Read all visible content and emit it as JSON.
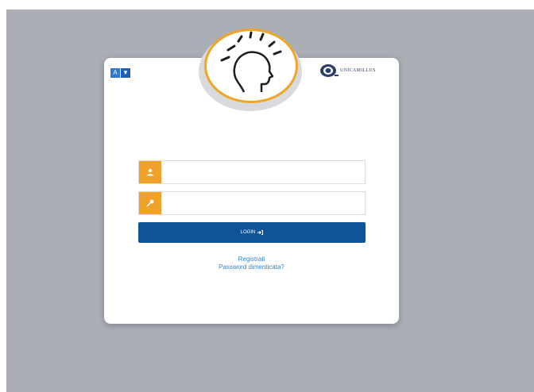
{
  "language": {
    "options": [
      "A",
      "▼"
    ]
  },
  "brand": {
    "name": "UNICAMILLUS"
  },
  "login": {
    "username": {
      "value": "",
      "placeholder": ""
    },
    "password": {
      "value": "",
      "placeholder": ""
    },
    "button_label": "LOGIN",
    "button_icon": "sign-in-icon"
  },
  "links": {
    "register": "Registrati",
    "forgot_password": "Password dimenticata?"
  },
  "colors": {
    "background": "#abaeb5",
    "card": "#ffffff",
    "accent_orange": "#f0a228",
    "button_blue": "#0f5499",
    "link_blue": "#2f84d2",
    "brand_navy": "#2b3d6b"
  },
  "icons": {
    "logo": "head-lightbulb-logo-icon",
    "brand_seal": "university-seal-icon",
    "user_field": "user-icon",
    "password_field": "key-icon"
  }
}
